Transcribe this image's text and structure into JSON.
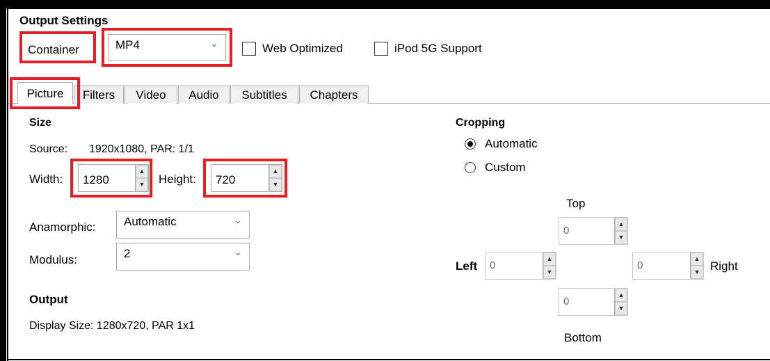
{
  "output_settings": {
    "title": "Output Settings",
    "container_label": "Container",
    "container_value": "MP4",
    "web_optimized_label": "Web Optimized",
    "ipod_label": "iPod 5G Support"
  },
  "tabs": [
    "Picture",
    "Filters",
    "Video",
    "Audio",
    "Subtitles",
    "Chapters"
  ],
  "size": {
    "title": "Size",
    "source_label": "Source:",
    "source_value": "1920x1080, PAR: 1/1",
    "width_label": "Width:",
    "width_value": "1280",
    "height_label": "Height:",
    "height_value": "720",
    "anamorphic_label": "Anamorphic:",
    "anamorphic_value": "Automatic",
    "modulus_label": "Modulus:",
    "modulus_value": "2"
  },
  "output": {
    "title": "Output",
    "display_size": "Display Size: 1280x720,  PAR 1x1"
  },
  "cropping": {
    "title": "Cropping",
    "automatic_label": "Automatic",
    "custom_label": "Custom",
    "selected": "Automatic",
    "top_label": "Top",
    "bottom_label": "Bottom",
    "left_label": "Left",
    "right_label": "Right",
    "top_value": "0",
    "bottom_value": "0",
    "left_value": "0",
    "right_value": "0"
  },
  "icons": {
    "spin_up": "▲",
    "spin_down": "▼",
    "chevron": "⌄"
  },
  "colors": {
    "highlight": "#e61e25"
  }
}
